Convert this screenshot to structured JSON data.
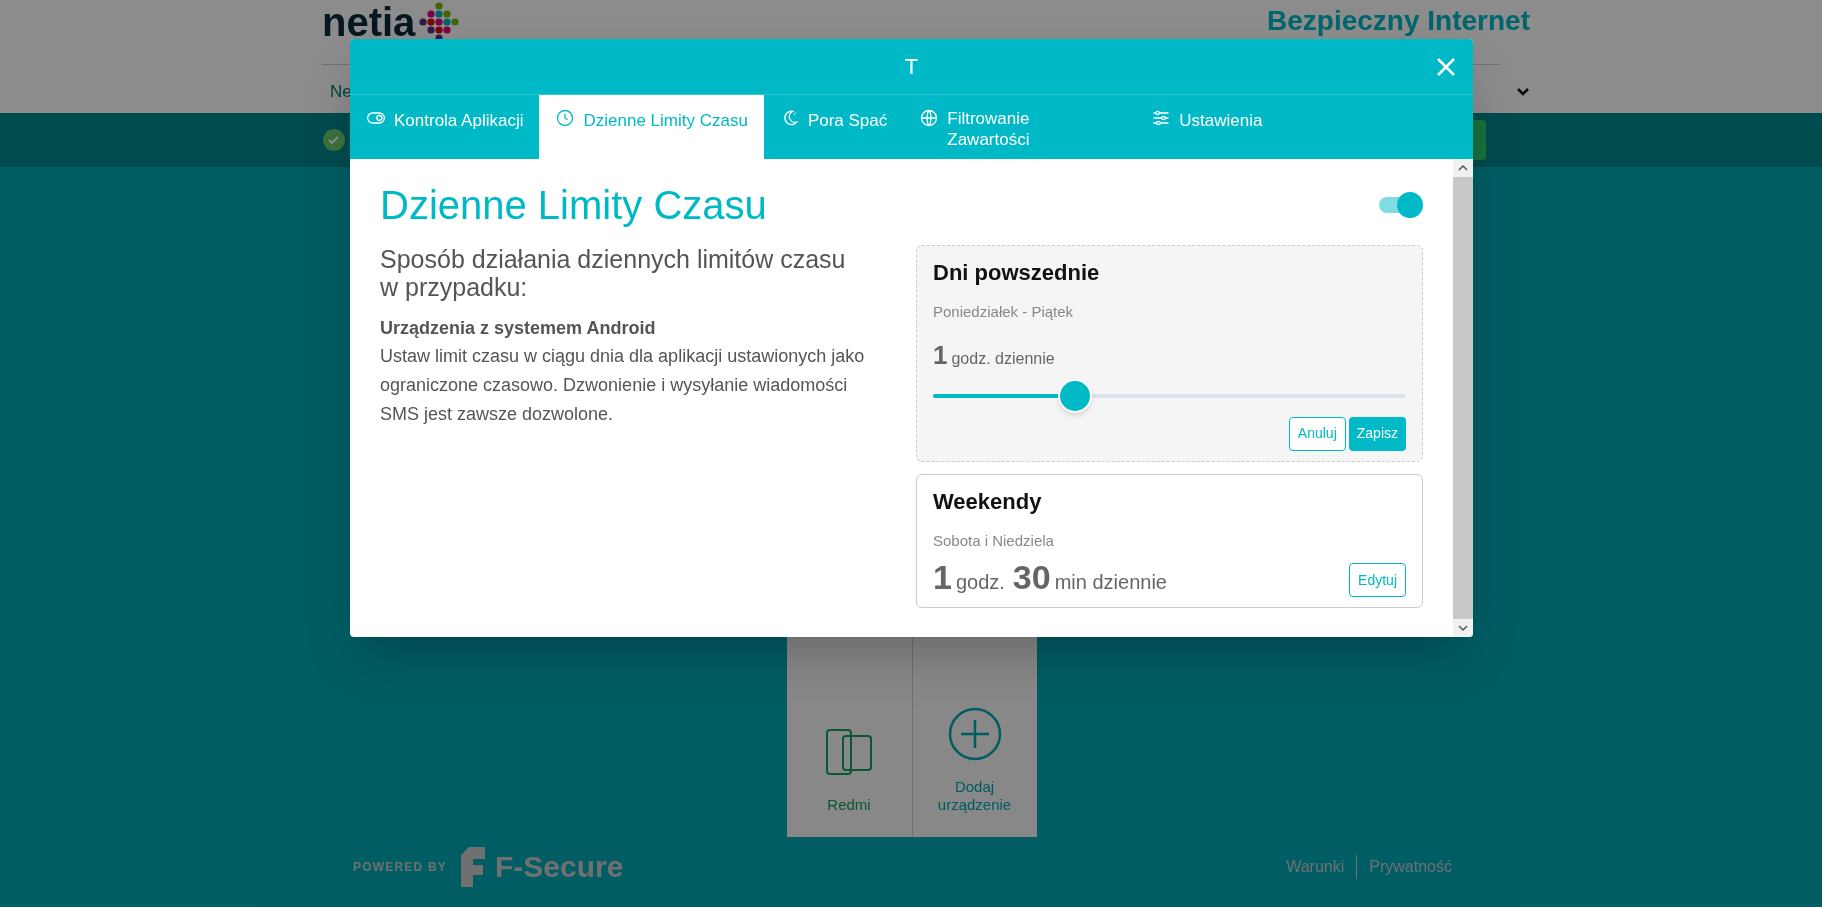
{
  "page": {
    "logo": "netia",
    "header_title": "Bezpieczny Internet",
    "nav_item": "Ne",
    "devices": [
      {
        "kind": "device",
        "name": "Redmi"
      },
      {
        "kind": "add",
        "name": "Dodaj urządzenie"
      }
    ],
    "footer": {
      "powered_by": "POWERED BY",
      "brand": "F-Secure",
      "links": [
        "Warunki",
        "Prywatność"
      ]
    }
  },
  "modal": {
    "title": "T",
    "tabs": [
      {
        "label": "Kontrola Aplikacji",
        "selected": false
      },
      {
        "label": "Dzienne Limity Czasu",
        "selected": true
      },
      {
        "label": "Pora Spać",
        "selected": false
      },
      {
        "label": "Filtrowanie Zawartości",
        "selected": false
      },
      {
        "label": "Ustawienia",
        "selected": false
      }
    ],
    "heading": "Dzienne Limity Czasu",
    "enabled": true,
    "intro": "Sposób działania dziennych limitów czasu w przypadku:",
    "subheading": "Urządzenia z systemem Android",
    "body": "Ustaw limit czasu w ciągu dnia dla aplikacji ustawionych jako ograniczone czasowo. Dzwonienie i wysyłanie wiadomości SMS jest zawsze dozwolone.",
    "schedules": [
      {
        "kind": "editing",
        "title": "Dni powszednie",
        "days": "Poniedziałek - Piątek",
        "hours": "1",
        "hours_unit": "godz. dziennie",
        "level": 0.3,
        "buttons": [
          "Anuluj",
          "Zapisz"
        ]
      },
      {
        "kind": "view",
        "title": "Weekendy",
        "days": "Sobota i Niedziela",
        "hours": "1",
        "hours_unit": "godz.",
        "minutes": "30",
        "minutes_unit": "min dziennie",
        "button": "Edytuj"
      }
    ]
  }
}
